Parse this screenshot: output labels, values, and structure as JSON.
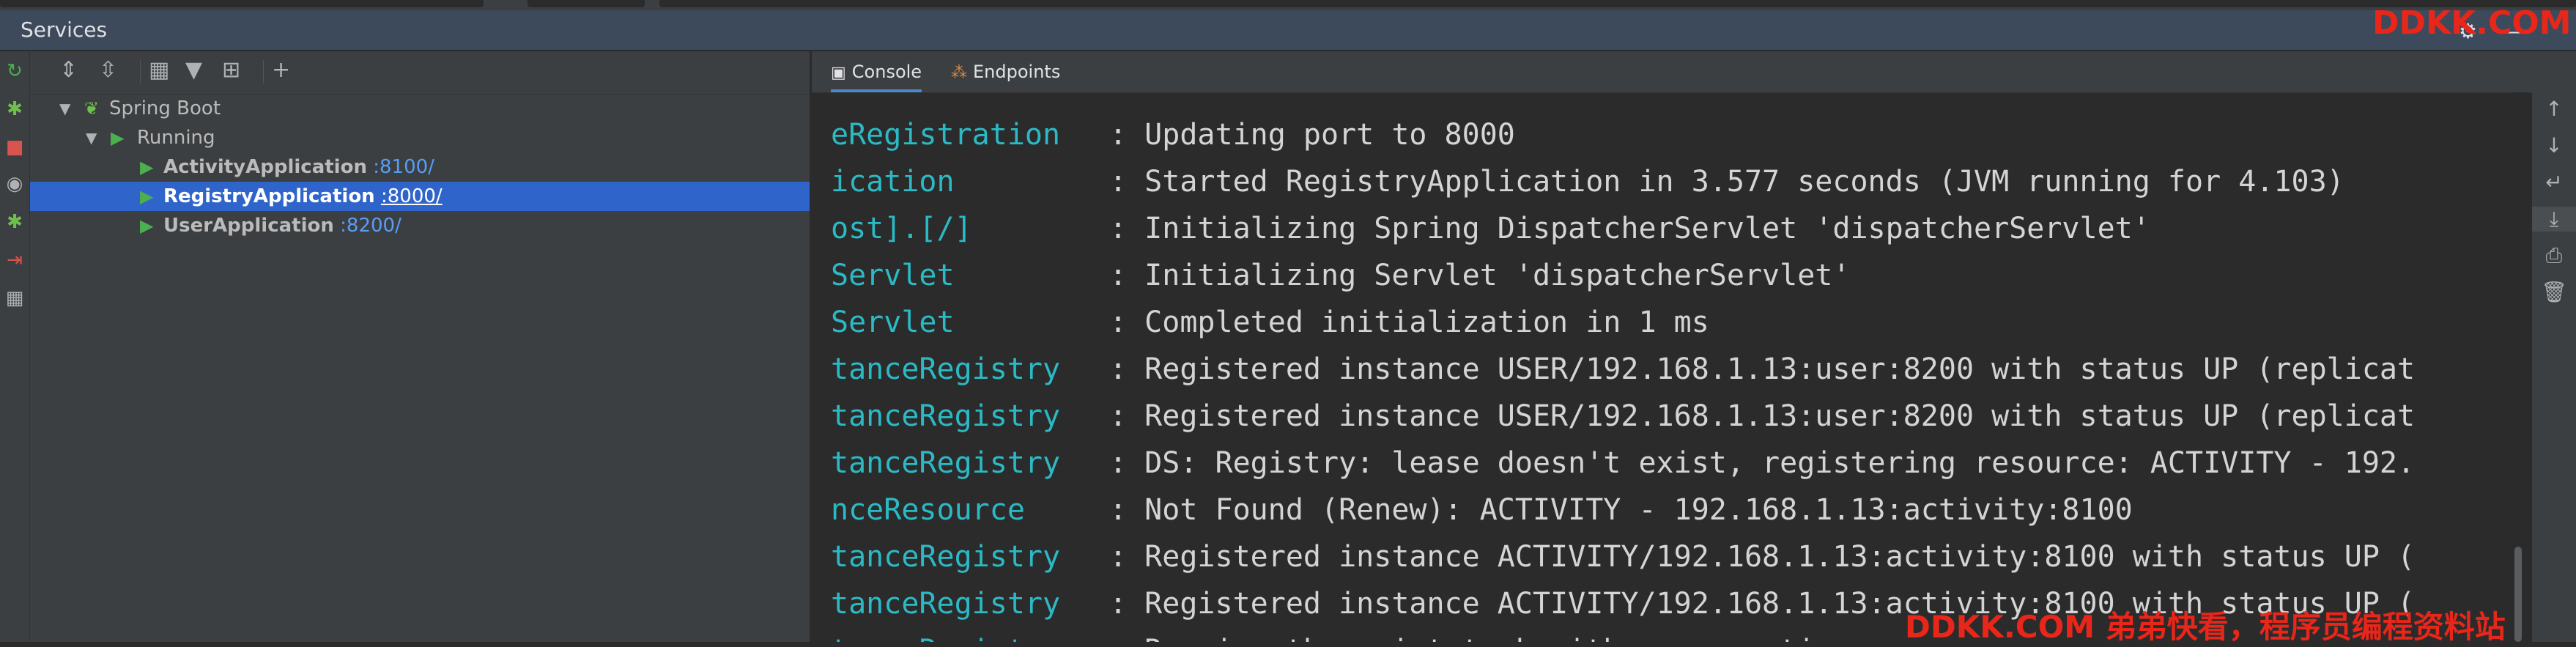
{
  "header": {
    "title": "Services"
  },
  "watermark": {
    "top": "DDKK.COM",
    "bottom": "DDKK.COM 弟弟快看，程序员编程资料站"
  },
  "tree": {
    "root": "Spring Boot",
    "group": "Running",
    "apps": [
      {
        "name": "ActivityApplication",
        "port": ":8100/"
      },
      {
        "name": "RegistryApplication",
        "port": ":8000/"
      },
      {
        "name": "UserApplication",
        "port": ":8200/"
      }
    ]
  },
  "console": {
    "tabs": [
      {
        "label": "Console"
      },
      {
        "label": "Endpoints"
      }
    ],
    "lines": [
      {
        "logger": "eRegistration",
        "msg": ": Updating port to 8000"
      },
      {
        "logger": "ication",
        "msg": ": Started RegistryApplication in 3.577 seconds (JVM running for 4.103)"
      },
      {
        "logger": "ost].[/]",
        "msg": ": Initializing Spring DispatcherServlet 'dispatcherServlet'"
      },
      {
        "logger": "Servlet",
        "msg": ": Initializing Servlet 'dispatcherServlet'"
      },
      {
        "logger": "Servlet",
        "msg": ": Completed initialization in 1 ms"
      },
      {
        "logger": "tanceRegistry",
        "msg": ": Registered instance USER/192.168.1.13:user:8200 with status UP (replicat"
      },
      {
        "logger": "tanceRegistry",
        "msg": ": Registered instance USER/192.168.1.13:user:8200 with status UP (replicat"
      },
      {
        "logger": "tanceRegistry",
        "msg": ": DS: Registry: lease doesn't exist, registering resource: ACTIVITY - 192."
      },
      {
        "logger": "nceResource",
        "msg": ": Not Found (Renew): ACTIVITY - 192.168.1.13:activity:8100"
      },
      {
        "logger": "tanceRegistry",
        "msg": ": Registered instance ACTIVITY/192.168.1.13:activity:8100 with status UP ("
      },
      {
        "logger": "tanceRegistry",
        "msg": ": Registered instance ACTIVITY/192.168.1.13:activity:8100 with status UP ("
      },
      {
        "logger": "tanceRegistry",
        "msg": ": Running the evict task with compensation"
      }
    ]
  }
}
